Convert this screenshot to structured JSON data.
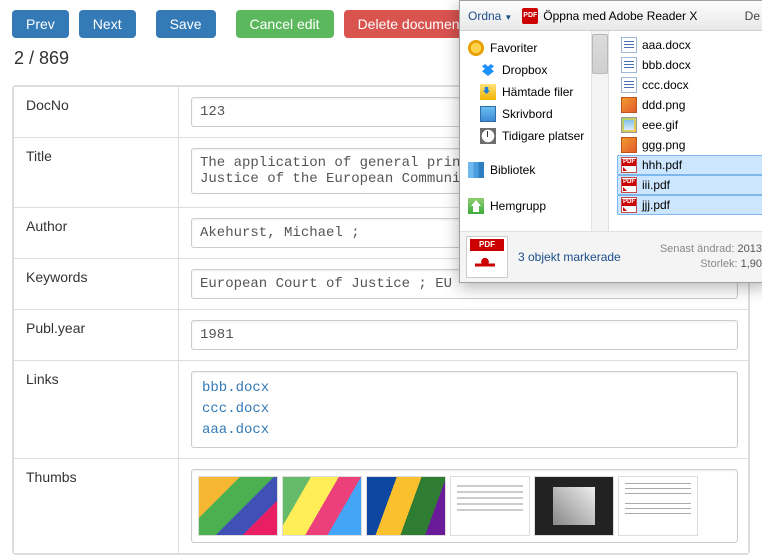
{
  "buttons": {
    "prev": "Prev",
    "next": "Next",
    "save": "Save",
    "cancel": "Cancel edit",
    "delete": "Delete document"
  },
  "counter": "2 / 869",
  "fields": {
    "docno": {
      "label": "DocNo",
      "value": "123"
    },
    "title": {
      "label": "Title",
      "value": "The application of general principles of law by the Court of Justice of the European Communities"
    },
    "author": {
      "label": "Author",
      "value": "Akehurst, Michael ;"
    },
    "keywords": {
      "label": "Keywords",
      "value": "European Court of Justice ; EU"
    },
    "publyear": {
      "label": "Publ.year",
      "value": "1981"
    },
    "links": {
      "label": "Links"
    },
    "thumbs": {
      "label": "Thumbs"
    }
  },
  "links": [
    "bbb.docx",
    "ccc.docx",
    "aaa.docx"
  ],
  "dialog": {
    "ordna": "Ordna",
    "open_with": "Öppna med Adobe Reader X",
    "de": "De",
    "nav": {
      "favoriter": "Favoriter",
      "dropbox": "Dropbox",
      "hamtade": "Hämtade filer",
      "skrivbord": "Skrivbord",
      "tidigare": "Tidigare platser",
      "bibliotek": "Bibliotek",
      "hemgrupp": "Hemgrupp"
    },
    "files": {
      "aaa": "aaa.docx",
      "bbb": "bbb.docx",
      "ccc": "ccc.docx",
      "ddd": "ddd.png",
      "eee": "eee.gif",
      "ggg": "ggg.png",
      "hhh": "hhh.pdf",
      "iii": "iii.pdf",
      "jjj": "jjj.pdf"
    },
    "status": {
      "selected": "3 objekt markerade",
      "changed_label": "Senast ändrad:",
      "changed_value": "2013",
      "size_label": "Storlek:",
      "size_value": "1,90"
    }
  }
}
